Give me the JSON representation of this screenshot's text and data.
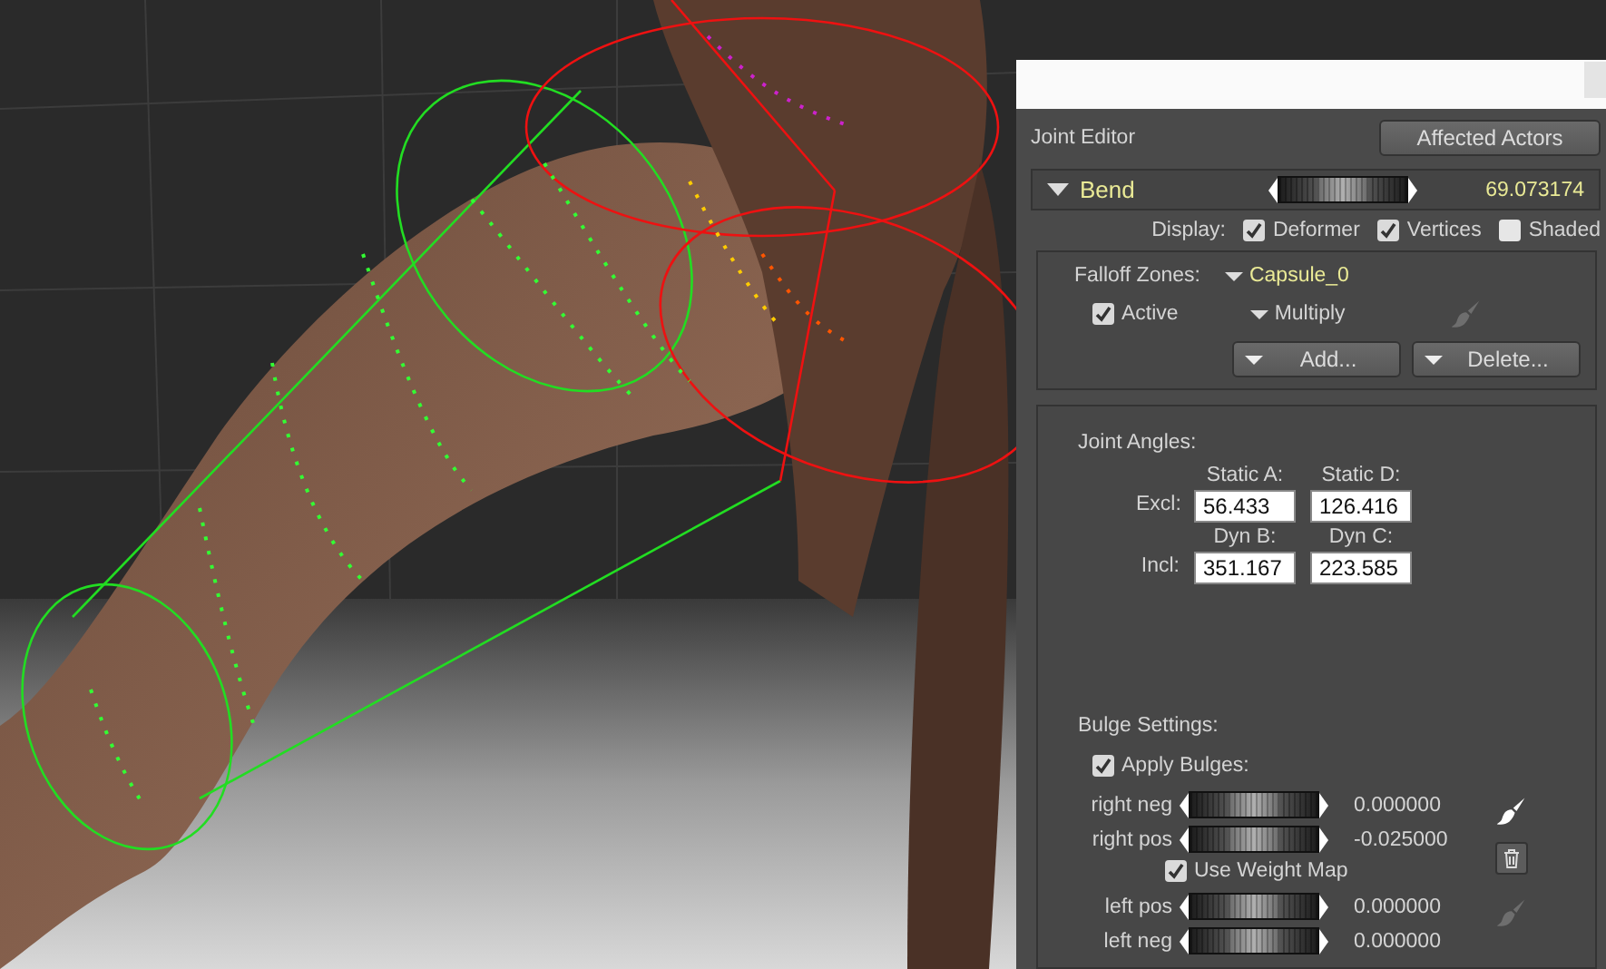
{
  "joint_editor": {
    "title": "Joint Editor",
    "affected_actors_button": "Affected Actors"
  },
  "bend": {
    "label": "Bend",
    "expanded": true,
    "level": 0.5,
    "value": "69.073174"
  },
  "display": {
    "label": "Display:",
    "options": [
      {
        "label": "Deformer",
        "checked": true
      },
      {
        "label": "Vertices",
        "checked": true
      },
      {
        "label": "Shaded",
        "checked": false
      }
    ]
  },
  "falloff": {
    "label": "Falloff Zones:",
    "zone": "Capsule_0",
    "active": {
      "label": "Active",
      "checked": true
    },
    "mode": "Multiply",
    "brush_enabled": false,
    "buttons": [
      "Add...",
      "Delete..."
    ]
  },
  "joint_angles": {
    "label": "Joint Angles:",
    "rows": [
      {
        "label": "Excl:",
        "fields": [
          {
            "label": "Static A:",
            "value": "56.433"
          },
          {
            "label": "Static D:",
            "value": "126.416"
          }
        ]
      },
      {
        "label": "Incl:",
        "fields": [
          {
            "label": "Dyn B:",
            "value": "351.167"
          },
          {
            "label": "Dyn C:",
            "value": "223.585"
          }
        ]
      }
    ]
  },
  "bulge": {
    "label": "Bulge Settings:",
    "apply": {
      "label": "Apply Bulges:",
      "checked": true
    },
    "groups": [
      {
        "sliders": [
          {
            "label": "right neg",
            "level": 0.5,
            "value": "0.000000"
          },
          {
            "label": "right pos",
            "level": 0.5,
            "value": "-0.025000"
          }
        ],
        "weight_map": {
          "label": "Use Weight Map",
          "checked": true
        },
        "brush_enabled": true,
        "trash": true
      },
      {
        "sliders": [
          {
            "label": "left pos",
            "level": 0.5,
            "value": "0.000000"
          },
          {
            "label": "left neg",
            "level": 0.5,
            "value": "0.000000"
          }
        ],
        "brush_enabled": false
      }
    ]
  }
}
